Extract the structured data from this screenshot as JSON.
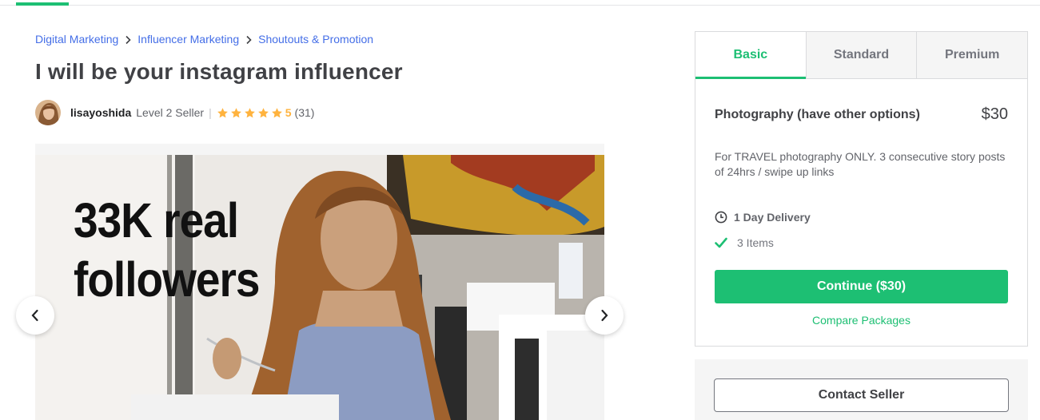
{
  "breadcrumb": {
    "items": [
      "Digital Marketing",
      "Influencer Marketing",
      "Shoutouts & Promotion"
    ]
  },
  "gig": {
    "title": "I will be your instagram influencer"
  },
  "seller": {
    "name": "lisayoshida",
    "level": "Level 2 Seller",
    "divider": "|",
    "rating": "5",
    "reviews": "(31)",
    "star_count": 5
  },
  "gallery": {
    "caption_line1": "33K real",
    "caption_line2": "followers"
  },
  "package": {
    "tabs": [
      "Basic",
      "Standard",
      "Premium"
    ],
    "active_tab": "Basic",
    "name": "Photography (have other options)",
    "price": "$30",
    "description": "For TRAVEL photography ONLY. 3 consecutive story posts of 24hrs / swipe up links",
    "delivery": "1 Day Delivery",
    "items": "3 Items",
    "continue_label": "Continue ($30)",
    "compare_label": "Compare Packages"
  },
  "contact": {
    "label": "Contact Seller"
  },
  "colors": {
    "accent": "#1dbf73",
    "link": "#446ee7",
    "star": "#ffb33e"
  }
}
